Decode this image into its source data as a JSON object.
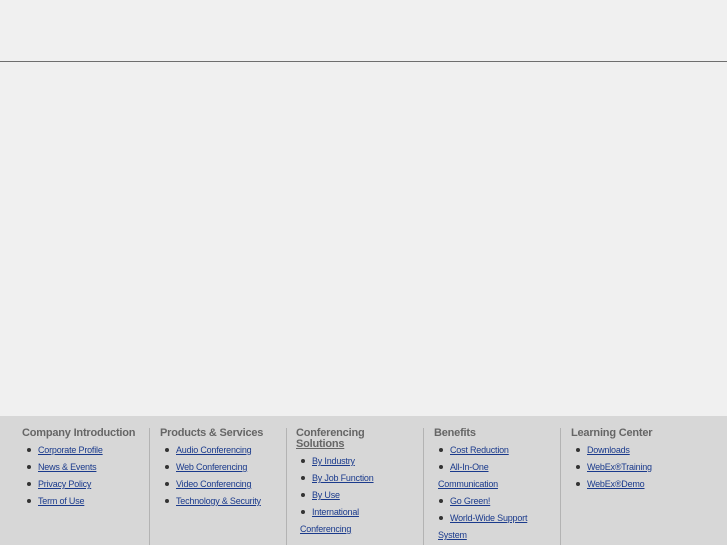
{
  "footer": {
    "columns": [
      {
        "title": "Company Introduction",
        "links": [
          "Corporate Profile",
          "News & Events",
          "Privacy Policy",
          "Term of Use"
        ]
      },
      {
        "title": "Products & Services",
        "links": [
          "Audio Conferencing",
          "Web Conferencing",
          "Video Conferencing",
          "Technology & Security"
        ]
      },
      {
        "title_line1": "Conferencing",
        "title_line2": "Solutions",
        "links": [
          "By Industry",
          "By Job Function",
          "By Use",
          "International",
          "Conferencing"
        ]
      },
      {
        "title": "Benefits",
        "links": [
          "Cost Reduction",
          "All-In-One",
          "Communication",
          "Go Green!",
          "World-Wide Support",
          "System"
        ]
      },
      {
        "title": "Learning Center",
        "links": [
          "Downloads",
          "WebEx®Training",
          "WebEx®Demo"
        ]
      }
    ]
  }
}
